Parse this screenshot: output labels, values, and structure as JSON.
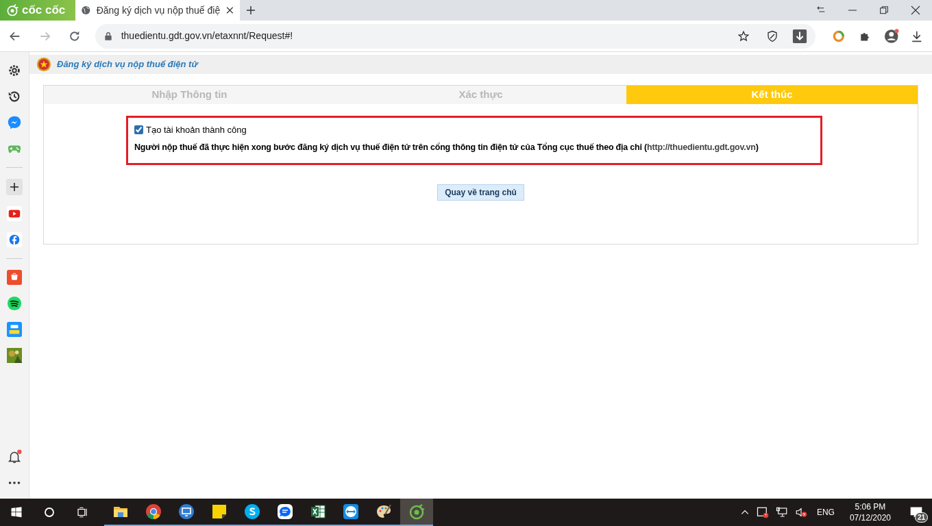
{
  "browser": {
    "brand": "cốc cốc",
    "tabs": [
      {
        "title": "Đăng ký dịch vụ nộp thuế điệ",
        "selected": true
      }
    ],
    "url": "thuedientu.gdt.gov.vn/etaxnnt/Request#!"
  },
  "page": {
    "header": "Đăng ký dịch vụ nộp thuế điện tử",
    "steps": [
      {
        "label": "Nhập Thông tin",
        "selected": false
      },
      {
        "label": "Xác thực",
        "selected": false
      },
      {
        "label": "Kết thúc",
        "selected": true
      }
    ],
    "result": {
      "checked": true,
      "title": "Tạo tài khoản thành công",
      "text": "Người nộp thuế đã thực hiện xong bước đăng ký dịch vụ thuế điện tử trên cổng thông tin điện tử của Tổng cục thuế theo địa chỉ (",
      "link": "http://thuedientu.gdt.gov.vn",
      "text_end": ")"
    },
    "button": "Quay về trang chủ"
  },
  "taskbar": {
    "apps": [
      {
        "kind": "folder",
        "selected": false
      },
      {
        "kind": "chrome",
        "selected": false
      },
      {
        "kind": "remote",
        "selected": false
      },
      {
        "kind": "note",
        "selected": false
      },
      {
        "kind": "skype",
        "selected": false
      },
      {
        "kind": "zalo",
        "selected": false
      },
      {
        "kind": "excel",
        "selected": false
      },
      {
        "kind": "teamviewer",
        "selected": false
      },
      {
        "kind": "paint",
        "selected": false
      },
      {
        "kind": "coccoc",
        "selected": true
      }
    ],
    "language": "ENG",
    "time": "5:06 PM",
    "date": "07/12/2020",
    "notifications": "21"
  }
}
